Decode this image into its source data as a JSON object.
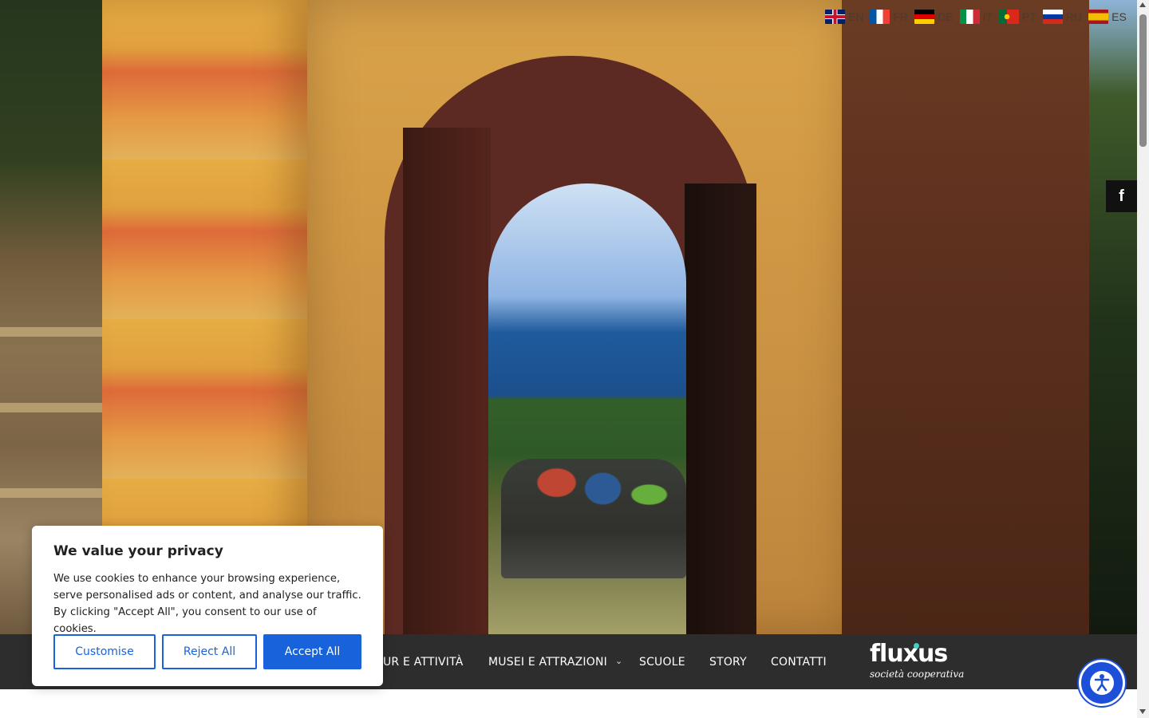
{
  "languages": [
    {
      "code": "EN",
      "flag": "flag-en"
    },
    {
      "code": "FR",
      "flag": "flag-fr"
    },
    {
      "code": "DE",
      "flag": "flag-de"
    },
    {
      "code": "IT",
      "flag": "flag-it"
    },
    {
      "code": "PT",
      "flag": "flag-pt"
    },
    {
      "code": "RU",
      "flag": "flag-ru"
    },
    {
      "code": "ES",
      "flag": "flag-es"
    }
  ],
  "social": {
    "facebook_label": "f",
    "icon": "facebook-icon"
  },
  "nav": {
    "items": [
      {
        "label": "TOUR E ATTIVITÀ"
      },
      {
        "label": "MUSEI E ATTRAZIONI",
        "chevron": "⌄"
      },
      {
        "label": "SCUOLE"
      },
      {
        "label": "STORY"
      },
      {
        "label": "CONTATTI"
      }
    ]
  },
  "logo": {
    "name": "fluxus",
    "tagline": "società cooperativa",
    "accent": "#3fd0c4"
  },
  "cookie": {
    "title": "We value your privacy",
    "body": "We use cookies to enhance your browsing experience, serve personalised ads or content, and analyse our traffic. By clicking \"Accept All\", you consent to our use of cookies.",
    "customise_label": "Customise",
    "reject_label": "Reject All",
    "accept_label": "Accept All",
    "accent": "#1863dc"
  },
  "accessibility": {
    "icon": "accessibility-icon",
    "color": "#1d4fd8"
  }
}
